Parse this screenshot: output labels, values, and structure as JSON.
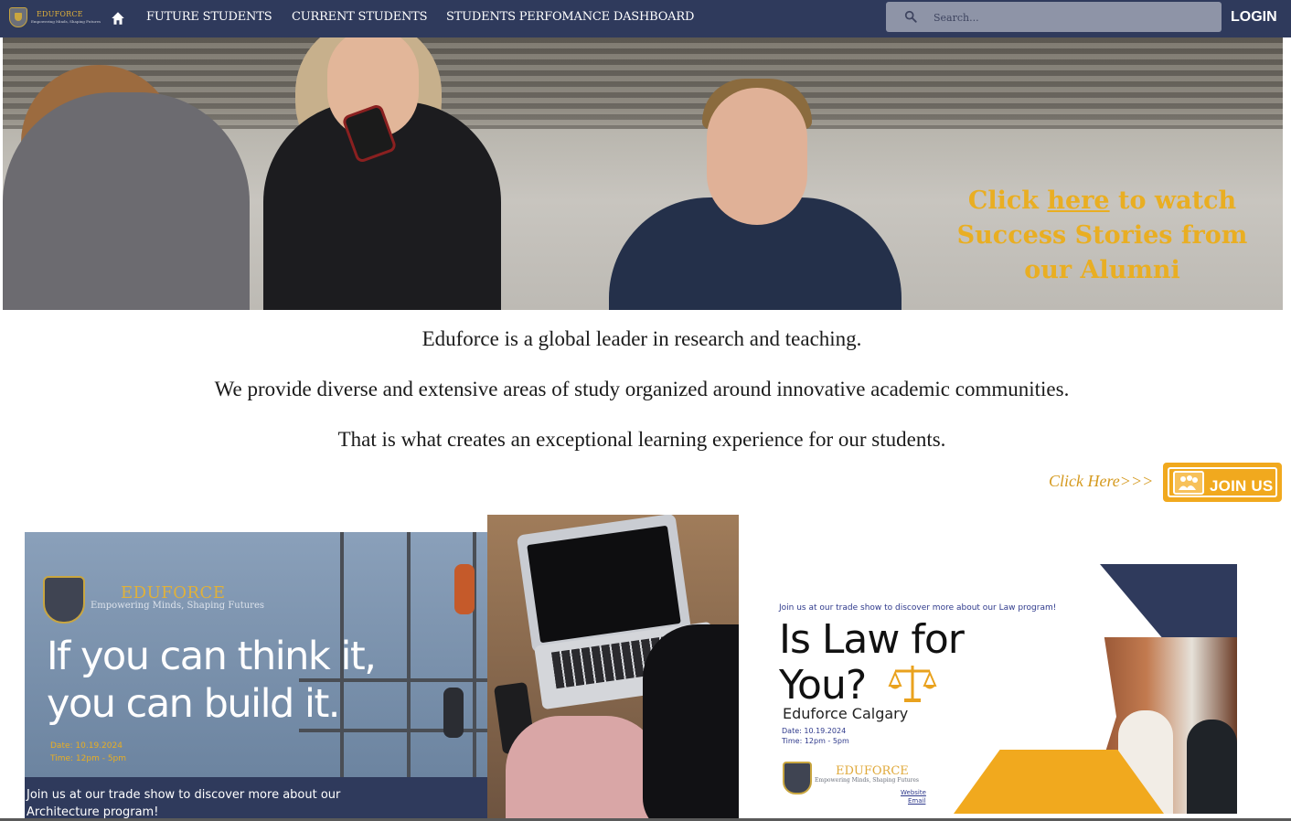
{
  "nav": {
    "logo_text": "EDUFORCE",
    "logo_tagline": "Empowering Minds, Shaping Futures",
    "links": [
      "FUTURE STUDENTS",
      "CURRENT STUDENTS",
      "STUDENTS PERFOMANCE DASHBOARD"
    ],
    "search_placeholder": "Search...",
    "login": "LOGIN",
    "colors": {
      "bar": "#2f3a5c",
      "search": "#8e94a7"
    }
  },
  "hero": {
    "caption_before": "Click ",
    "caption_link": "here",
    "caption_after": " to watch Success Stories from our Alumni",
    "caption_color": "#e9ae22"
  },
  "intro": {
    "lines": [
      "Eduforce is a global leader in research and teaching.",
      "We provide diverse and extensive areas of study organized around innovative academic communities.",
      "That is what creates an exceptional learning experience for our students."
    ]
  },
  "join": {
    "prompt": "Click Here>>>",
    "button": "JOIN US",
    "color": "#f1a91e"
  },
  "cards": {
    "arch": {
      "brand": "EDUFORCE",
      "tagline": "Empowering Minds, Shaping Futures",
      "title": "If you can think it, you can build it.",
      "date": "Date: 10.19.2024",
      "time": "Time: 12pm - 5pm",
      "band": "Join us at our trade show to discover more about our Architecture program!"
    },
    "law": {
      "top": "Join us at our trade show to discover more about our Law program!",
      "title": "Is Law for You?",
      "subtitle": "Eduforce Calgary",
      "date": "Date: 10.19.2024",
      "time": "Time: 12pm - 5pm",
      "brand": "EDUFORCE",
      "tagline": "Empowering Minds, Shaping Futures",
      "link_website": "Website",
      "link_email": "Email"
    }
  }
}
